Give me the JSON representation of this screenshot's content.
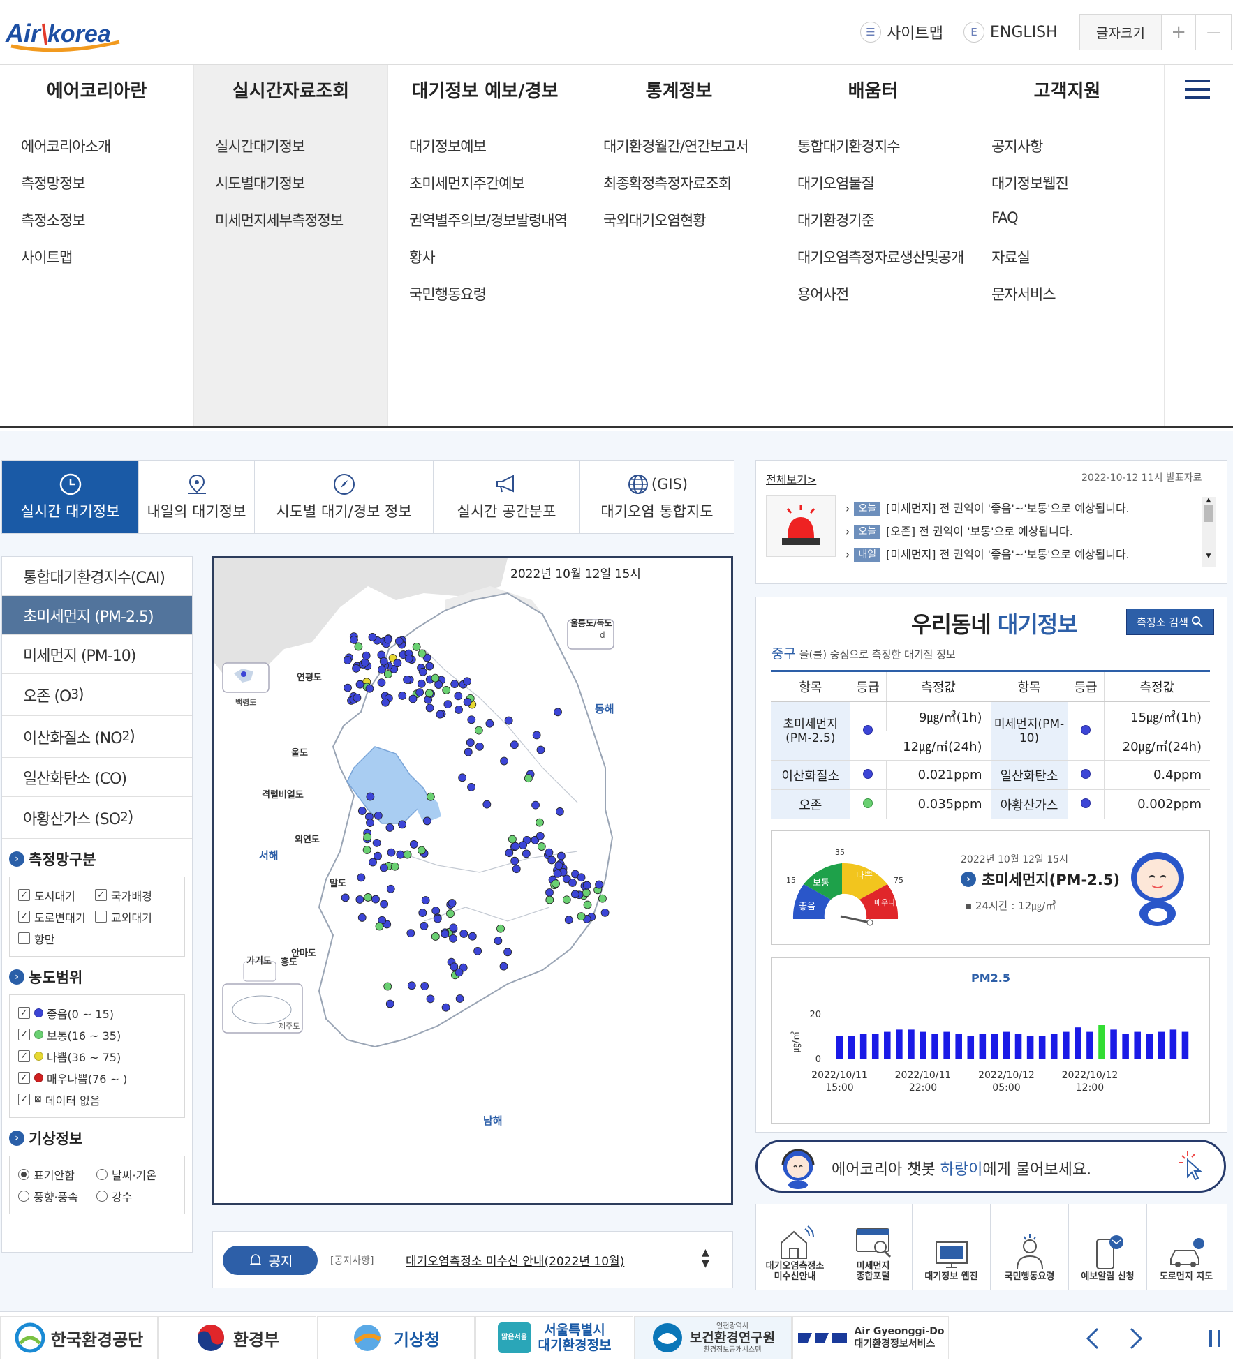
{
  "header": {
    "logo_text": "Air korea",
    "sitemap_label": "사이트맵",
    "english_label": "ENGLISH",
    "font_size_label": "글자크기",
    "plus": "+",
    "minus": "—"
  },
  "gnb": {
    "items": [
      "에어코리아란",
      "실시간자료조회",
      "대기정보 예보/경보",
      "통계정보",
      "배움터",
      "고객지원"
    ],
    "submenus": [
      [
        "에어코리아소개",
        "측정망정보",
        "측정소정보",
        "사이트맵"
      ],
      [
        "실시간대기정보",
        "시도별대기정보",
        "미세먼지세부측정정보"
      ],
      [
        "대기정보예보",
        "초미세먼지주간예보",
        "권역별주의보/경보발령내역",
        "황사",
        "국민행동요령"
      ],
      [
        "대기환경월간/연간보고서",
        "최종확정측정자료조회",
        "국외대기오염현황"
      ],
      [
        "통합대기환경지수",
        "대기오염물질",
        "대기환경기준",
        "대기오염측정자료생산및공개",
        "용어사전"
      ],
      [
        "공지사항",
        "대기정보웹진",
        "FAQ",
        "자료실",
        "문자서비스"
      ]
    ]
  },
  "tabs": [
    {
      "label": "실시간 대기정보",
      "icon": "clock-icon"
    },
    {
      "label": "내일의 대기정보",
      "icon": "pin-icon"
    },
    {
      "label": "시도별 대기/경보 정보",
      "icon": "compass-icon"
    },
    {
      "label": "실시간 공간분포",
      "icon": "megaphone-icon"
    },
    {
      "label": "대기오염 통합지도",
      "icon": "globe-icon",
      "top": "(GIS)"
    }
  ],
  "pollutants": [
    {
      "label": "통합대기환경지수(CAI)",
      "sub": ""
    },
    {
      "label": "초미세먼지 (PM-2.5)",
      "sub": ""
    },
    {
      "label": "미세먼지 (PM-10)",
      "sub": ""
    },
    {
      "label": "오존 (O",
      "sub": "3",
      "close": ")"
    },
    {
      "label": "이산화질소 (NO",
      "sub": "2",
      "close": ")"
    },
    {
      "label": "일산화탄소 (CO)",
      "sub": ""
    },
    {
      "label": "아황산가스 (SO",
      "sub": "2",
      "close": ")"
    }
  ],
  "network": {
    "title": "측정망구분",
    "items": [
      {
        "label": "도시대기",
        "checked": true
      },
      {
        "label": "국가배경",
        "checked": true
      },
      {
        "label": "도로변대기",
        "checked": true
      },
      {
        "label": "교외대기",
        "checked": false
      },
      {
        "label": "항만",
        "checked": false
      }
    ]
  },
  "range": {
    "title": "농도범위",
    "items": [
      {
        "label": "좋음(0 ~ 15)",
        "color": "#3c45d6"
      },
      {
        "label": "보통(16 ~ 35)",
        "color": "#6ad072"
      },
      {
        "label": "나쁨(36 ~ 75)",
        "color": "#e6d832"
      },
      {
        "label": "매우나쁨(76 ~ )",
        "color": "#d02020"
      },
      {
        "label": "데이터 없음",
        "color": "none"
      }
    ]
  },
  "weather": {
    "title": "기상정보",
    "items": [
      "표기안함",
      "날씨·기온",
      "풍향·풍속",
      "강수"
    ]
  },
  "map": {
    "timestamp": "2022년 10월 12일 15시",
    "labels": {
      "yeonpyeong": "연평도",
      "baengnyeong": "백령도",
      "ulleung": "울릉도/독도",
      "east_sea": "동해",
      "west_sea": "서해",
      "south_sea": "남해",
      "uldo": "울도",
      "gyeokryeol": "격렬비열도",
      "oeyeon": "외연도",
      "maldo": "말도",
      "anmado": "안마도",
      "gageo": "가거도",
      "hongdo": "홍도",
      "jeju": "제주도"
    },
    "dokdo": "d"
  },
  "notice": {
    "badge": "공지",
    "category": "[공지사항]",
    "title": "대기오염측정소 미수신 안내(2022년 10월)"
  },
  "alert": {
    "view_all": "전체보기>",
    "date": "2022-10-12 11시 발표자료",
    "items": [
      {
        "tag": "오늘",
        "text": "[미세먼지] 전 권역이 '좋음'~'보통'으로 예상됩니다."
      },
      {
        "tag": "오늘",
        "text": "[오존] 전 권역이 '보통'으로 예상됩니다."
      },
      {
        "tag": "내일",
        "text": "[미세먼지] 전 권역이 '좋음'~'보통'으로 예상됩니다."
      }
    ]
  },
  "local": {
    "title_a": "우리동네 ",
    "title_b": "대기정보",
    "search_btn": "측정소 검색",
    "district": "중구",
    "district_desc": " 을(를) 중심으로 측정한 대기질 정보",
    "headers": [
      "항목",
      "등급",
      "측정값",
      "항목",
      "등급",
      "측정값"
    ],
    "pm25": {
      "name": "초미세먼지\n(PM-2.5)",
      "v1": "9㎍/㎥(1h)",
      "v2": "12㎍/㎥(24h)"
    },
    "pm10": {
      "name": "미세먼지(PM-10)",
      "v1": "15㎍/㎥(1h)",
      "v2": "20㎍/㎥(24h)"
    },
    "no2": {
      "name": "이산화질소",
      "v": "0.021ppm"
    },
    "co": {
      "name": "일산화탄소",
      "v": "0.4ppm"
    },
    "o3": {
      "name": "오존",
      "v": "0.035ppm"
    },
    "so2": {
      "name": "아황산가스",
      "v": "0.002ppm"
    },
    "gauge": {
      "labels": [
        "좋음",
        "보통",
        "나쁨",
        "매우나쁨"
      ],
      "ticks": [
        "15",
        "35",
        "75"
      ],
      "level": 0.05,
      "date": "2022년 10월 12일 15시",
      "item": "초미세먼지(PM-2.5)",
      "avg": "24시간 : 12㎍/㎥"
    }
  },
  "chart_data": {
    "type": "bar",
    "title": "PM2.5",
    "ylabel": "㎍/㎥",
    "ylim": [
      0,
      25
    ],
    "yticks": [
      "0",
      "20"
    ],
    "xticks": [
      "2022/10/11\n15:00",
      "2022/10/11\n22:00",
      "2022/10/12\n05:00",
      "2022/10/12\n12:00"
    ],
    "values": [
      10,
      10,
      11,
      11,
      12,
      13,
      13,
      12,
      11,
      12,
      11,
      10,
      11,
      11,
      12,
      11,
      10,
      10,
      11,
      12,
      14,
      12,
      15,
      13,
      11,
      12,
      11,
      12,
      13,
      12
    ],
    "highlight_index": 22,
    "colors": {
      "normal": "#1a1ae6",
      "highlight": "#33dd33"
    }
  },
  "chatbot": {
    "a": "에어코리아 챗봇 ",
    "b": "하랑이",
    "c": "에게 물어보세요."
  },
  "quicklinks": [
    "대기오염측정소\n미수신안내",
    "미세먼지\n종합포털",
    "대기정보 웹진",
    "국민행동요령",
    "예보알림 신청",
    "도로먼지 지도"
  ],
  "footer": {
    "orgs": [
      "한국환경공단",
      "환경부",
      "기상청",
      "서울특별시\n대기환경정보",
      "보건환경연구원",
      "Air Gyeonggi-Do\n대기환경정보서비스"
    ],
    "seoul_badge": "맑은서울",
    "incheon_small": "인천광역시",
    "incheon_sub": "환경정보공개시스템"
  },
  "colors": {
    "primary": "#1a5aa6",
    "active_tab": "#1a5aa6",
    "active_pollutant": "#52749c",
    "good": "#3c45d6",
    "normal": "#6ad072",
    "bad": "#e6d832",
    "very_bad": "#d02020"
  }
}
